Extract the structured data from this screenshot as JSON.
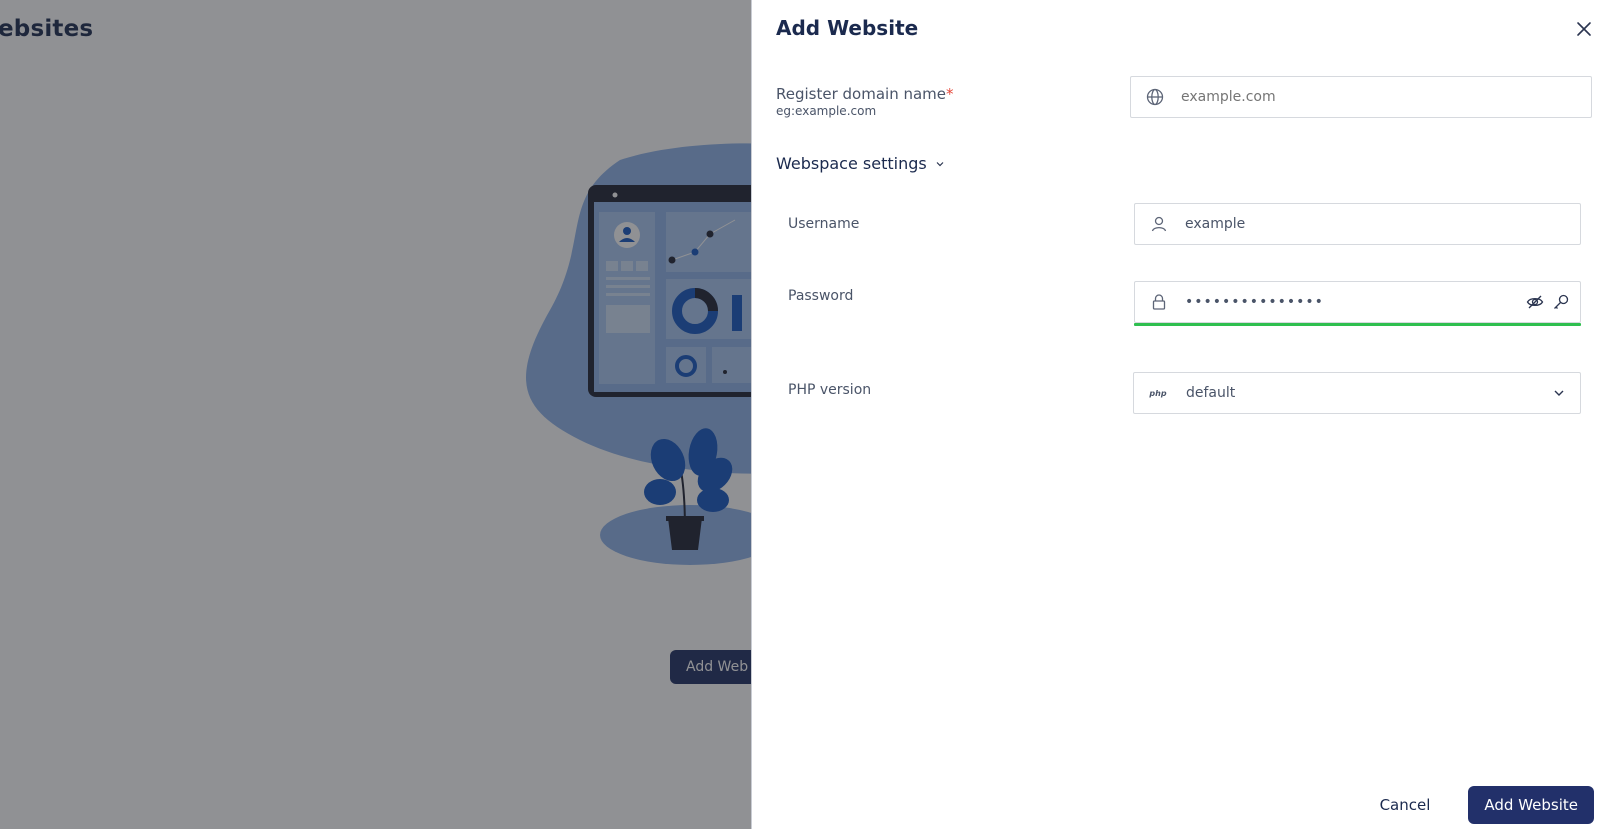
{
  "background": {
    "page_title": "ebsites",
    "add_button_label": "Add Web"
  },
  "drawer": {
    "title": "Add Website",
    "domain": {
      "label": "Register domain name",
      "required_mark": "*",
      "hint": "eg:example.com",
      "placeholder": "example.com",
      "icon": "globe-icon"
    },
    "webspace_section": {
      "label": "Webspace settings",
      "expanded": true
    },
    "username": {
      "label": "Username",
      "value": "example",
      "icon": "user-icon"
    },
    "password": {
      "label": "Password",
      "value": "•••••••••••••••",
      "icon": "lock-icon",
      "strength_color": "#2fbf4f"
    },
    "php": {
      "label": "PHP version",
      "selected": "default",
      "badge": "php"
    },
    "footer": {
      "cancel_label": "Cancel",
      "submit_label": "Add Website"
    }
  },
  "colors": {
    "primary": "#22306a",
    "text_dark": "#1b2a4e",
    "required": "#e5483a"
  }
}
